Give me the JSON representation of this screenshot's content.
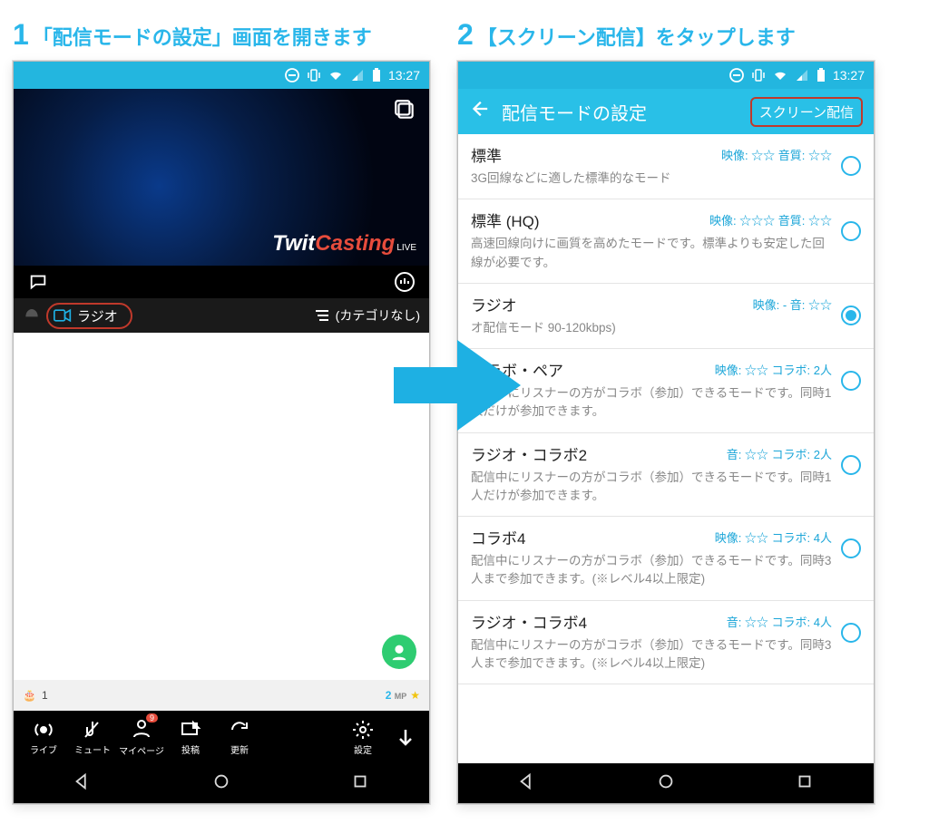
{
  "steps": {
    "step1_num": "1",
    "step1_text": "「配信モードの設定」画面を開きます",
    "step2_num": "2",
    "step2_text": "【スクリーン配信】をタップします"
  },
  "statusbar": {
    "time": "13:27"
  },
  "screen1": {
    "brand_a": "Twit",
    "brand_b": "Casting",
    "brand_live": "LIVE",
    "radio_label": "ラジオ",
    "category_none": "(カテゴリなし)",
    "mp_value": "2",
    "mp_unit": "MP",
    "mp_level": "1",
    "nav": {
      "live": "ライブ",
      "mute": "ミュート",
      "mypage": "マイページ",
      "post": "投稿",
      "refresh": "更新",
      "settings": "設定"
    }
  },
  "screen2": {
    "title": "配信モードの設定",
    "screen_button": "スクリーン配信",
    "modes": [
      {
        "title": "標準",
        "meta": "映像: ☆☆ 音質: ☆☆",
        "desc": "3G回線などに適した標準的なモード",
        "selected": false
      },
      {
        "title": "標準 (HQ)",
        "meta": "映像: ☆☆☆ 音質: ☆☆",
        "desc": "高速回線向けに画質を高めたモードです。標準よりも安定した回線が必要です。",
        "selected": false
      },
      {
        "title": "ラジオ",
        "meta": "映像: - 音: ☆☆",
        "desc": "オ配信モード 90-120kbps)",
        "selected": true
      },
      {
        "title": "コラボ・ペア",
        "meta": "映像: ☆☆ コラボ: 2人",
        "desc": "配信中にリスナーの方がコラボ（参加）できるモードです。同時1人だけが参加できます。",
        "selected": false
      },
      {
        "title": "ラジオ・コラボ2",
        "meta": "音: ☆☆ コラボ: 2人",
        "desc": "配信中にリスナーの方がコラボ（参加）できるモードです。同時1人だけが参加できます。",
        "selected": false
      },
      {
        "title": "コラボ4",
        "meta": "映像: ☆☆ コラボ: 4人",
        "desc": "配信中にリスナーの方がコラボ（参加）できるモードです。同時3人まで参加できます。(※レベル4以上限定)",
        "selected": false
      },
      {
        "title": "ラジオ・コラボ4",
        "meta": "音: ☆☆ コラボ: 4人",
        "desc": "配信中にリスナーの方がコラボ（参加）できるモードです。同時3人まで参加できます。(※レベル4以上限定)",
        "selected": false
      }
    ]
  }
}
